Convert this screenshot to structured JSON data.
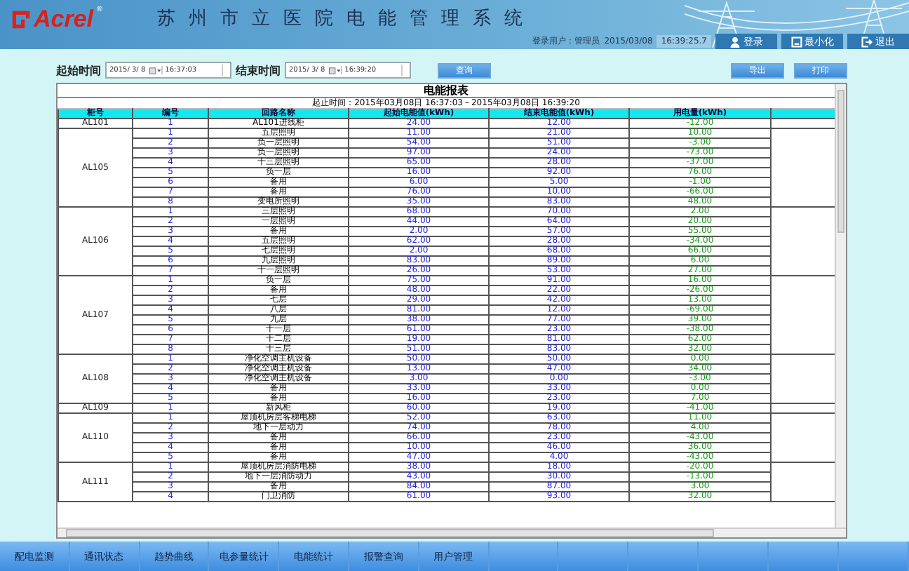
{
  "header": {
    "logo": "Acrel",
    "logo_mark": "®",
    "title": "苏州市立医院电能管理系统",
    "user": "登录用户：管理员",
    "date": "2015/03/08",
    "time": "16:39:25.7",
    "actions": [
      {
        "kind": "login",
        "label": "登录"
      },
      {
        "kind": "minimize",
        "label": "最小化"
      },
      {
        "kind": "exit",
        "label": "退出"
      }
    ]
  },
  "filters": {
    "start_label": "起始时间",
    "start_date": "2015/ 3/ 8",
    "start_time": "16:37:03",
    "end_label": "结束时间",
    "end_date": "2015/ 3/ 8",
    "end_time": "16:39:20",
    "query": "查询",
    "export": "导出",
    "print": "打印"
  },
  "report": {
    "title": "电能报表",
    "range": "起止时间：2015年03月08日 16:37:03－2015年03月08日 16:39:20",
    "columns": [
      "柜号",
      "编号",
      "回路名称",
      "起始电能值(kWh)",
      "结束电能值(kWh)",
      "用电量(kWh)"
    ],
    "groups": [
      {
        "cabinet": "AL101",
        "rows": [
          {
            "no": "1",
            "name": "AL101进线柜",
            "start": "24.00",
            "end": "12.00",
            "usage": "-12.00"
          }
        ]
      },
      {
        "cabinet": "AL105",
        "rows": [
          {
            "no": "1",
            "name": "五层照明",
            "start": "11.00",
            "end": "21.00",
            "usage": "10.00"
          },
          {
            "no": "2",
            "name": "负一层照明",
            "start": "54.00",
            "end": "51.00",
            "usage": "-3.00"
          },
          {
            "no": "3",
            "name": "负一层照明",
            "start": "97.00",
            "end": "24.00",
            "usage": "-73.00"
          },
          {
            "no": "4",
            "name": "十三层照明",
            "start": "65.00",
            "end": "28.00",
            "usage": "-37.00"
          },
          {
            "no": "5",
            "name": "负一层",
            "start": "16.00",
            "end": "92.00",
            "usage": "76.00"
          },
          {
            "no": "6",
            "name": "备用",
            "start": "6.00",
            "end": "5.00",
            "usage": "-1.00"
          },
          {
            "no": "7",
            "name": "备用",
            "start": "76.00",
            "end": "10.00",
            "usage": "-66.00"
          },
          {
            "no": "8",
            "name": "变电所照明",
            "start": "35.00",
            "end": "83.00",
            "usage": "48.00"
          }
        ]
      },
      {
        "cabinet": "AL106",
        "rows": [
          {
            "no": "1",
            "name": "三层照明",
            "start": "68.00",
            "end": "70.00",
            "usage": "2.00"
          },
          {
            "no": "2",
            "name": "一层照明",
            "start": "44.00",
            "end": "64.00",
            "usage": "20.00"
          },
          {
            "no": "3",
            "name": "备用",
            "start": "2.00",
            "end": "57.00",
            "usage": "55.00"
          },
          {
            "no": "4",
            "name": "五层照明",
            "start": "62.00",
            "end": "28.00",
            "usage": "-34.00"
          },
          {
            "no": "5",
            "name": "七层照明",
            "start": "2.00",
            "end": "68.00",
            "usage": "66.00"
          },
          {
            "no": "6",
            "name": "九层照明",
            "start": "83.00",
            "end": "89.00",
            "usage": "6.00"
          },
          {
            "no": "7",
            "name": "十一层照明",
            "start": "26.00",
            "end": "53.00",
            "usage": "27.00"
          }
        ]
      },
      {
        "cabinet": "AL107",
        "rows": [
          {
            "no": "1",
            "name": "负一层",
            "start": "75.00",
            "end": "91.00",
            "usage": "16.00"
          },
          {
            "no": "2",
            "name": "备用",
            "start": "48.00",
            "end": "22.00",
            "usage": "-26.00"
          },
          {
            "no": "3",
            "name": "七层",
            "start": "29.00",
            "end": "42.00",
            "usage": "13.00"
          },
          {
            "no": "4",
            "name": "八层",
            "start": "81.00",
            "end": "12.00",
            "usage": "-69.00"
          },
          {
            "no": "5",
            "name": "九层",
            "start": "38.00",
            "end": "77.00",
            "usage": "39.00"
          },
          {
            "no": "6",
            "name": "十一层",
            "start": "61.00",
            "end": "23.00",
            "usage": "-38.00"
          },
          {
            "no": "7",
            "name": "十二层",
            "start": "19.00",
            "end": "81.00",
            "usage": "62.00"
          },
          {
            "no": "8",
            "name": "十三层",
            "start": "51.00",
            "end": "83.00",
            "usage": "32.00"
          }
        ]
      },
      {
        "cabinet": "AL108",
        "rows": [
          {
            "no": "1",
            "name": "净化空调主机设备",
            "start": "50.00",
            "end": "50.00",
            "usage": "0.00"
          },
          {
            "no": "2",
            "name": "净化空调主机设备",
            "start": "13.00",
            "end": "47.00",
            "usage": "34.00"
          },
          {
            "no": "3",
            "name": "净化空调主机设备",
            "start": "3.00",
            "end": "0.00",
            "usage": "-3.00"
          },
          {
            "no": "4",
            "name": "备用",
            "start": "33.00",
            "end": "33.00",
            "usage": "0.00"
          },
          {
            "no": "5",
            "name": "备用",
            "start": "16.00",
            "end": "23.00",
            "usage": "7.00"
          }
        ]
      },
      {
        "cabinet": "AL109",
        "rows": [
          {
            "no": "1",
            "name": "新风柜",
            "start": "60.00",
            "end": "19.00",
            "usage": "-41.00"
          }
        ]
      },
      {
        "cabinet": "AL110",
        "rows": [
          {
            "no": "1",
            "name": "屋顶机房层客梯电梯",
            "start": "52.00",
            "end": "63.00",
            "usage": "11.00"
          },
          {
            "no": "2",
            "name": "地下一层动力",
            "start": "74.00",
            "end": "78.00",
            "usage": "4.00"
          },
          {
            "no": "3",
            "name": "备用",
            "start": "66.00",
            "end": "23.00",
            "usage": "-43.00"
          },
          {
            "no": "4",
            "name": "备用",
            "start": "10.00",
            "end": "46.00",
            "usage": "36.00"
          },
          {
            "no": "5",
            "name": "备用",
            "start": "47.00",
            "end": "4.00",
            "usage": "-43.00"
          }
        ]
      },
      {
        "cabinet": "AL111",
        "rows": [
          {
            "no": "1",
            "name": "屋顶机房层消防电梯",
            "start": "38.00",
            "end": "18.00",
            "usage": "-20.00"
          },
          {
            "no": "2",
            "name": "地下一层消防动力",
            "start": "43.00",
            "end": "30.00",
            "usage": "-13.00"
          },
          {
            "no": "3",
            "name": "备用",
            "start": "84.00",
            "end": "87.00",
            "usage": "3.00"
          },
          {
            "no": "4",
            "name": "门卫消防",
            "start": "61.00",
            "end": "93.00",
            "usage": "32.00"
          }
        ]
      }
    ]
  },
  "nav": [
    "配电监测",
    "通讯状态",
    "趋势曲线",
    "电参量统计",
    "电能统计",
    "报警查询",
    "用户管理"
  ]
}
